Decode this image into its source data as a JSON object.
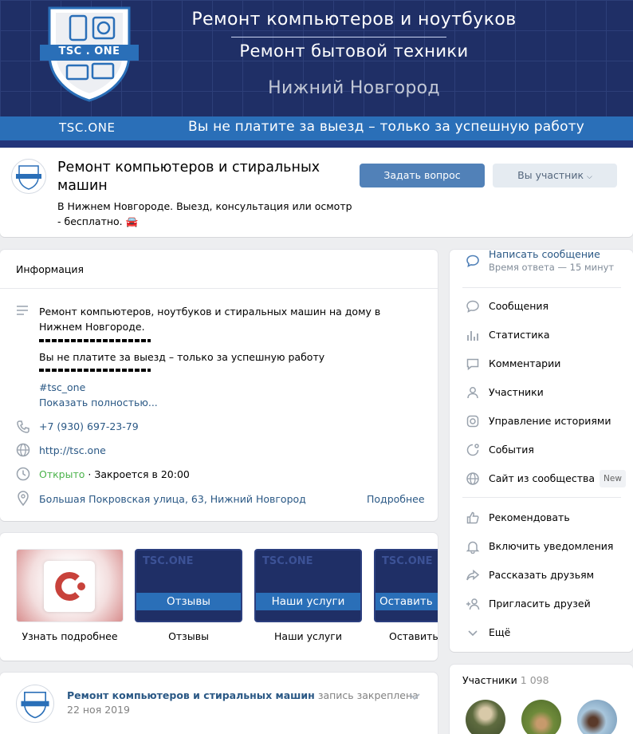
{
  "cover": {
    "line1": "Ремонт компьютеров и ноутбуков",
    "line2": "Ремонт бытовой техники",
    "city": "Нижний Новгород",
    "site": "TSC.ONE",
    "slogan": "Вы не платите за выезд – только за успешную работу",
    "logo_text": "TSC . ONE"
  },
  "group": {
    "title": "Ремонт компьютеров и стиральных машин",
    "status": "В Нижнем Новгороде. Выезд, консультация или осмотр - бесплатно. 🚘",
    "ask_button": "Задать вопрос",
    "member_button": "Вы участник"
  },
  "info": {
    "heading": "Информация",
    "description_1": "Ремонт компьютеров, ноутбуков и стиральных машин на дому в Нижнем Новгороде.",
    "description_2": "Вы не платите за выезд – только за успешную работу",
    "hashtag": "#tsc_one",
    "show_more": "Показать полностью...",
    "phone": "+7 (930) 697-23-79",
    "site": "http://tsc.one",
    "open": "Открыто",
    "closes": "· Закроется в 20:00",
    "address": "Большая Покровская улица, 63, Нижний Новгород",
    "details": "Подробнее"
  },
  "menu": {
    "write": "Написать сообщение",
    "reply_time": "Время ответа — 15 минут",
    "messages": "Сообщения",
    "stats": "Статистика",
    "comments": "Комментарии",
    "members": "Участники",
    "stories": "Управление историями",
    "events": "События",
    "site": "Сайт из сообщества",
    "new_badge": "New",
    "recommend": "Рекомендовать",
    "notify": "Включить уведомления",
    "share": "Рассказать друзьям",
    "invite": "Пригласить друзей",
    "more": "Ещё"
  },
  "links": [
    {
      "caption": "Узнать подробнее",
      "band": ""
    },
    {
      "caption": "Отзывы",
      "band": "Отзывы"
    },
    {
      "caption": "Наши услуги",
      "band": "Наши услуги"
    },
    {
      "caption": "Оставить з",
      "band": "Оставить"
    }
  ],
  "tile_mark": "TSC.ONE",
  "post": {
    "author": "Ремонт компьютеров и стиральных машин",
    "action": "запись закреплена",
    "date": "22 ноя 2019"
  },
  "members_block": {
    "label": "Участники",
    "count": "1 098"
  },
  "colors": {
    "accent": "#5181b8",
    "link": "#2a5885",
    "cover_bg": "#1f2f66",
    "cover_strip": "#2a6fb8",
    "open_green": "#4bb34b"
  }
}
